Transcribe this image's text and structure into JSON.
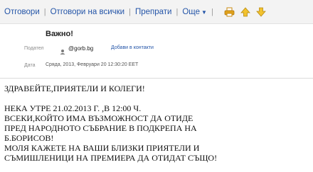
{
  "toolbar": {
    "reply": "Отговори",
    "reply_all": "Отговори на всички",
    "forward": "Препрати",
    "more": "Още"
  },
  "header": {
    "subject": "Важно!",
    "from_label": "Подател",
    "sender": "@gorb.bg",
    "add_contact": "Добави в контакти",
    "date_label": "Дата",
    "date": "Сряда, 2013, Февруари 20 12:30:20 EET"
  },
  "body": {
    "greeting": "ЗДРАВЕЙТЕ,ПРИЯТЕЛИ И КОЛЕГИ!",
    "line1": "НЕКА УТРЕ 21.02.2013 Г. ,В 12:00 Ч.",
    "line2": "ВСЕКИ,КОЙТО ИМА ВЪЗМОЖНОСТ ДА ОТИДЕ",
    "line3": "ПРЕД НАРОДНОТО СЪБРАНИЕ В ПОДКРЕПА НА",
    "line4": "Б.БОРИСОВ!",
    "line5": "МОЛЯ КАЖЕТЕ НА ВАШИ БЛИЗКИ ПРИЯТЕЛИ И",
    "line6": "СЪМИШЛЕНИЦИ НА ПРЕМИЕРА ДА ОТИДАТ СЪЩО!"
  },
  "icons": {
    "print": "print-icon",
    "prev": "arrow-up-icon",
    "next": "arrow-down-icon"
  },
  "colors": {
    "link": "#2455a8",
    "toolbar_bg": "#f3f3f3",
    "icon": "#e0a21b"
  }
}
